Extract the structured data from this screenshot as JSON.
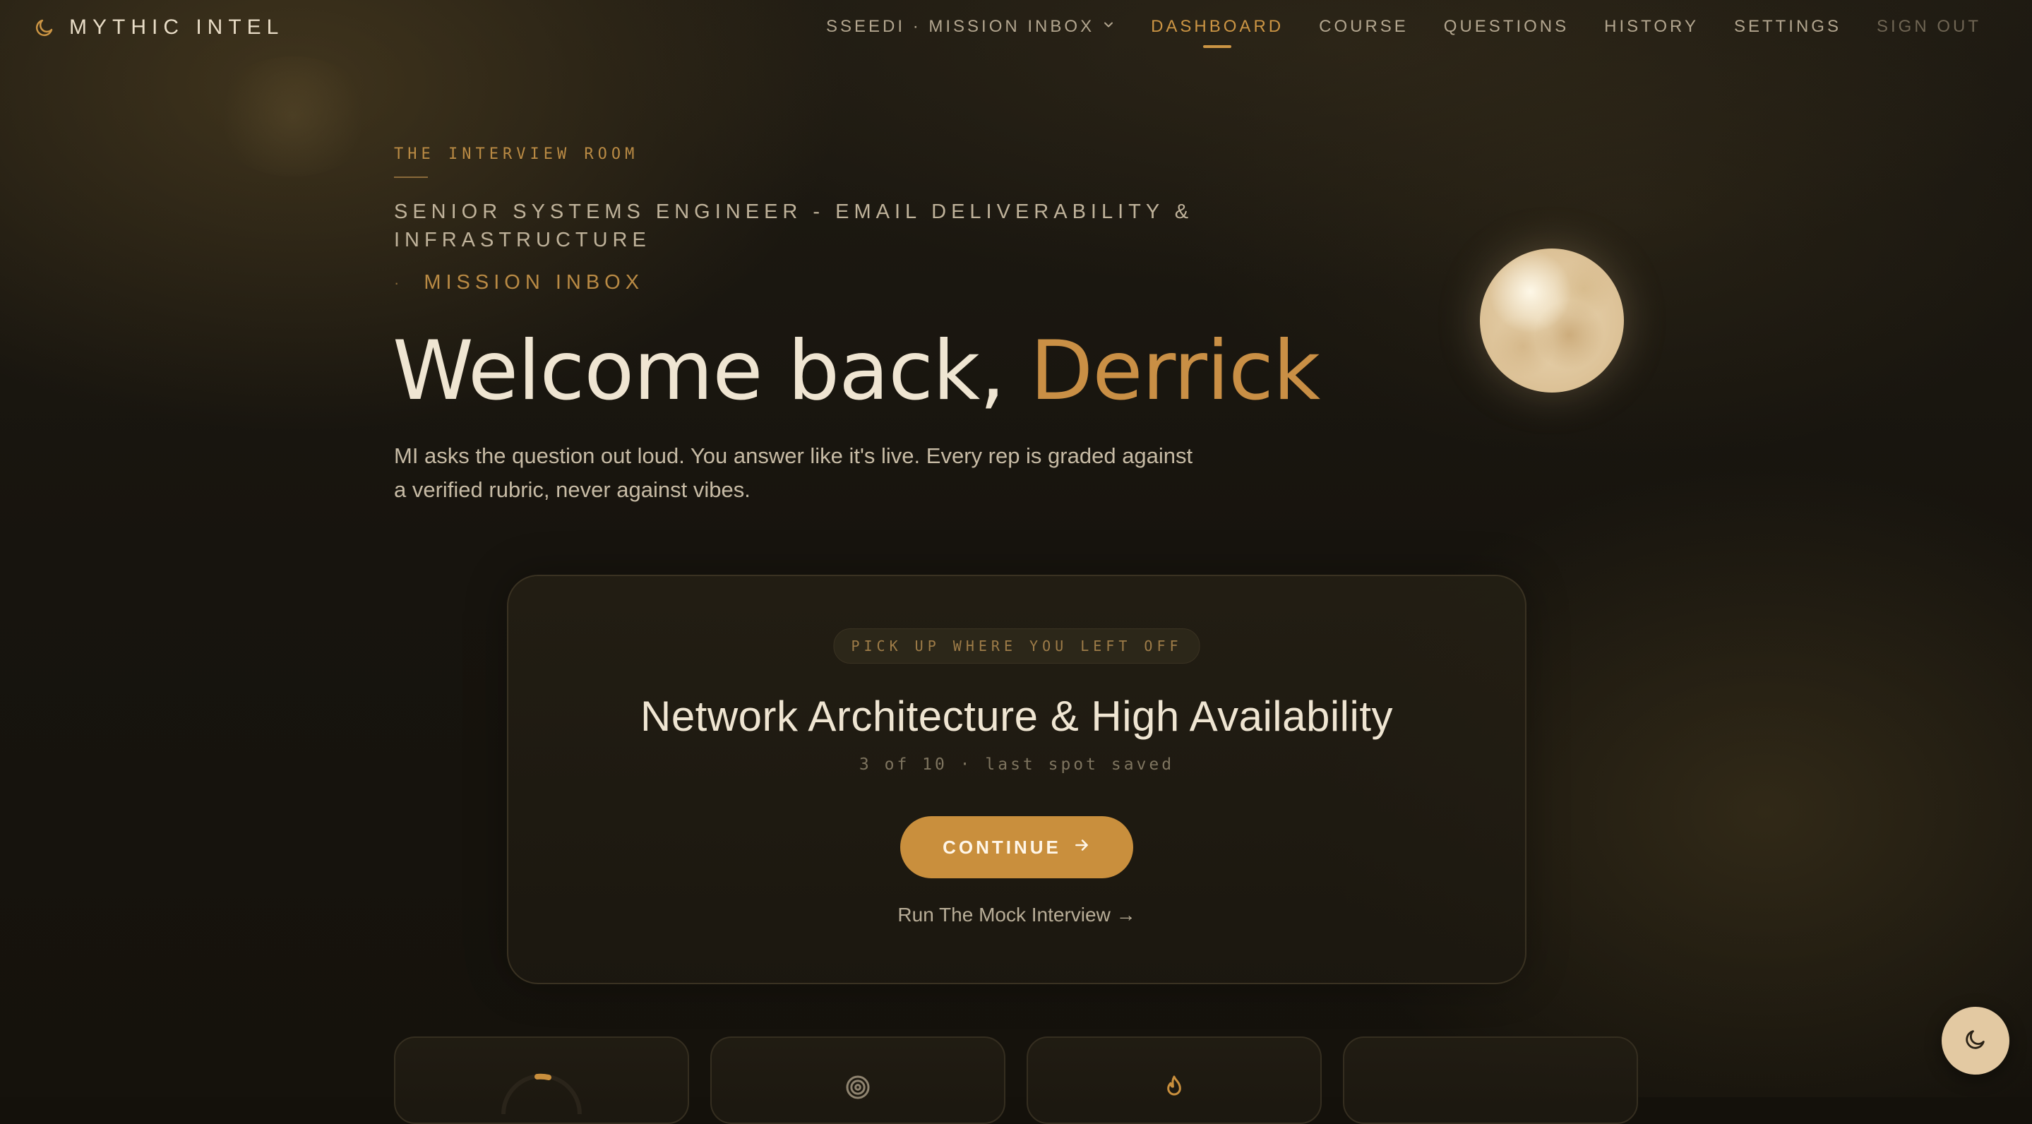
{
  "app": {
    "brand_name": "MYTHIC INTEL"
  },
  "nav": {
    "workspace_label": "SSEEDI · MISSION INBOX",
    "items": [
      "DASHBOARD",
      "COURSE",
      "QUESTIONS",
      "HISTORY",
      "SETTINGS"
    ],
    "active_item": "DASHBOARD",
    "sign_out_label": "SIGN OUT"
  },
  "hero": {
    "eyebrow": "THE INTERVIEW ROOM",
    "role": "SENIOR SYSTEMS ENGINEER - EMAIL DELIVERABILITY & INFRASTRUCTURE",
    "company_bullet": "·",
    "company": "MISSION INBOX",
    "greeting": "Welcome back, ",
    "user_name": "Derrick",
    "intro": "MI asks the question out loud. You answer like it's live. Every rep is graded against a verified rubric, never against vibes."
  },
  "resume_card": {
    "pill_label": "PICK UP WHERE YOU LEFT OFF",
    "title": "Network Architecture & High Availability",
    "progress_text": "3 of 10 · last spot saved",
    "continue_label": "CONTINUE",
    "mock_link_label": "Run The Mock Interview →"
  },
  "stat_tiles": [
    {
      "icon": "progress-ring-icon"
    },
    {
      "icon": "target-icon"
    },
    {
      "icon": "flame-icon"
    },
    {
      "icon": ""
    }
  ],
  "colors": {
    "accent": "#c98f3d",
    "accent_text": "#cc9544",
    "background": "#14110b",
    "text_primary": "#efe5d2",
    "text_muted": "#b3a68f"
  },
  "theme_toggle_icon": "moon-icon"
}
